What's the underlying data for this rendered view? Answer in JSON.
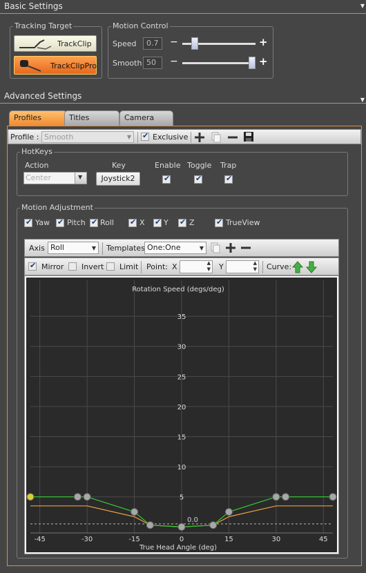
{
  "basic": {
    "header": "Basic Settings",
    "tracking_target": {
      "title": "Tracking Target",
      "btn_trackclip": "TrackClip",
      "btn_trackclippro": "TrackClipPro"
    },
    "motion_control": {
      "title": "Motion Control",
      "speed_label": "Speed",
      "speed_value": "0.7",
      "speed_level": 0.14,
      "smooth_label": "Smooth",
      "smooth_value": "50",
      "smooth_level": 1.0,
      "minus": "−",
      "plus": "+"
    }
  },
  "advanced": {
    "header": "Advanced Settings",
    "tabs": [
      "Profiles",
      "Titles",
      "Camera"
    ],
    "profile": {
      "label": "Profile :",
      "value": "Smooth",
      "exclusive_label": "Exclusive"
    },
    "hotkeys": {
      "title": "HotKeys",
      "col_action": "Action",
      "col_key": "Key",
      "col_enable": "Enable",
      "col_toggle": "Toggle",
      "col_trap": "Trap",
      "action_value": "Center",
      "key_value": "Joystick2"
    },
    "motion_adjustment": {
      "title": "Motion Adjustment",
      "axes": [
        "Yaw",
        "Pitch",
        "Roll",
        "X",
        "Y",
        "Z",
        "TrueView"
      ],
      "axis_label": "Axis",
      "axis_value": "Roll",
      "templates_label": "Templates",
      "templates_value": "One:One",
      "mirror_label": "Mirror",
      "invert_label": "Invert",
      "limit_label": "Limit",
      "point_label": "Point:",
      "x_label": "X",
      "y_label": "Y",
      "curve_label": "Curve:"
    }
  },
  "chart_data": {
    "type": "line",
    "title": "Rotation Speed (degs/deg)",
    "xlabel": "True Head Angle (deg)",
    "ylabel": "",
    "xlim": [
      -48,
      48
    ],
    "ylim": [
      -1,
      38
    ],
    "x_ticks": [
      -45,
      -30,
      -15,
      0,
      15,
      30,
      45
    ],
    "y_ticks": [
      5,
      10,
      15,
      20,
      25,
      30,
      35
    ],
    "dashed_line_label": "0.0",
    "dashed_line_y": 0.5,
    "series": [
      {
        "color": "#33cc33",
        "points": [
          [
            -48,
            5
          ],
          [
            -33,
            5
          ],
          [
            -30,
            5
          ],
          [
            -15,
            2.5
          ],
          [
            -10,
            0.3
          ],
          [
            0,
            0
          ],
          [
            10,
            0.3
          ],
          [
            15,
            2.5
          ],
          [
            30,
            5
          ],
          [
            33,
            5
          ],
          [
            48,
            5
          ]
        ],
        "markers": [
          [
            -48,
            5
          ],
          [
            -33,
            5
          ],
          [
            -30,
            5
          ],
          [
            -15,
            2.5
          ],
          [
            -10,
            0.3
          ],
          [
            0,
            0
          ],
          [
            10,
            0.3
          ],
          [
            15,
            2.5
          ],
          [
            30,
            5
          ],
          [
            33,
            5
          ],
          [
            48,
            5
          ]
        ]
      },
      {
        "color": "#e8a040",
        "points": [
          [
            -48,
            3.5
          ],
          [
            -30,
            3.5
          ],
          [
            -15,
            1.7
          ],
          [
            -10,
            0.3
          ],
          [
            0,
            0
          ],
          [
            10,
            0.3
          ],
          [
            15,
            1.7
          ],
          [
            30,
            3.5
          ],
          [
            48,
            3.5
          ]
        ]
      }
    ],
    "grid": true,
    "background": "#2a2a2a"
  }
}
